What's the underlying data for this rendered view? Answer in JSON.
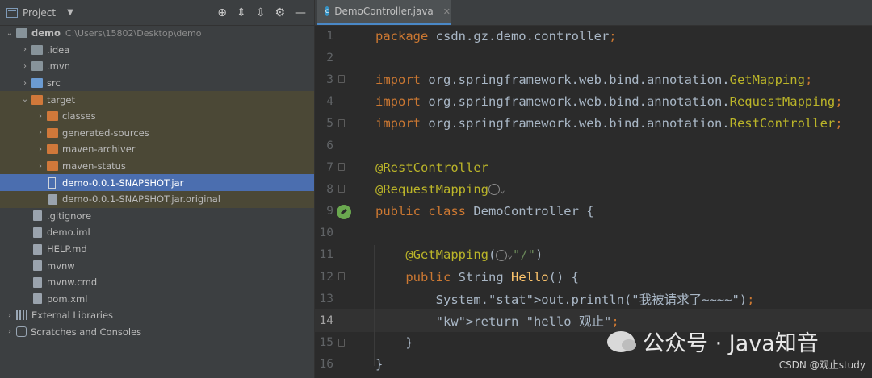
{
  "project_panel": {
    "title": "Project",
    "tree": [
      {
        "label": "demo",
        "path": "C:\\Users\\15802\\Desktop\\demo",
        "indent": 0,
        "arrow": "open",
        "icon": "folder-blue"
      },
      {
        "label": ".idea",
        "indent": 1,
        "arrow": "closed",
        "icon": "folder-blue"
      },
      {
        "label": ".mvn",
        "indent": 1,
        "arrow": "closed",
        "icon": "folder-blue"
      },
      {
        "label": "src",
        "indent": 1,
        "arrow": "closed",
        "icon": "folder-src"
      },
      {
        "label": "target",
        "indent": 1,
        "arrow": "open",
        "icon": "folder-orange"
      },
      {
        "label": "classes",
        "indent": 2,
        "arrow": "closed",
        "icon": "folder-orange"
      },
      {
        "label": "generated-sources",
        "indent": 2,
        "arrow": "closed",
        "icon": "folder-orange"
      },
      {
        "label": "maven-archiver",
        "indent": 2,
        "arrow": "closed",
        "icon": "folder-orange"
      },
      {
        "label": "maven-status",
        "indent": 2,
        "arrow": "closed",
        "icon": "folder-orange"
      },
      {
        "label": "demo-0.0.1-SNAPSHOT.jar",
        "indent": 2,
        "arrow": "",
        "icon": "jar"
      },
      {
        "label": "demo-0.0.1-SNAPSHOT.jar.original",
        "indent": 2,
        "arrow": "",
        "icon": "file"
      },
      {
        "label": ".gitignore",
        "indent": 1,
        "arrow": "",
        "icon": "file"
      },
      {
        "label": "demo.iml",
        "indent": 1,
        "arrow": "",
        "icon": "file"
      },
      {
        "label": "HELP.md",
        "indent": 1,
        "arrow": "",
        "icon": "file"
      },
      {
        "label": "mvnw",
        "indent": 1,
        "arrow": "",
        "icon": "file"
      },
      {
        "label": "mvnw.cmd",
        "indent": 1,
        "arrow": "",
        "icon": "file"
      },
      {
        "label": "pom.xml",
        "indent": 1,
        "arrow": "",
        "icon": "file"
      },
      {
        "label": "External Libraries",
        "indent": 0,
        "arrow": "closed",
        "icon": "library"
      },
      {
        "label": "Scratches and Consoles",
        "indent": 0,
        "arrow": "closed",
        "icon": "scratch"
      }
    ],
    "selected_item": "demo-0.0.1-SNAPSHOT.jar",
    "target_highlight_items": [
      "target",
      "classes",
      "generated-sources",
      "maven-archiver",
      "maven-status",
      "demo-0.0.1-SNAPSHOT.jar.original"
    ]
  },
  "editor": {
    "tab_label": "DemoController.java",
    "current_line": 14,
    "lines": [
      "package csdn.gz.demo.controller;",
      "",
      "import org.springframework.web.bind.annotation.GetMapping;",
      "import org.springframework.web.bind.annotation.RequestMapping;",
      "import org.springframework.web.bind.annotation.RestController;",
      "",
      "@RestController",
      "@RequestMapping",
      "public class DemoController {",
      "",
      "    @GetMapping(\"/\")",
      "    public String Hello() {",
      "        System.out.println(\"我被请求了~~~~\");",
      "        return \"hello 观止\";",
      "    }",
      "}"
    ]
  },
  "watermark": {
    "main": "公众号 · Java知音",
    "small": "CSDN @观止study"
  }
}
